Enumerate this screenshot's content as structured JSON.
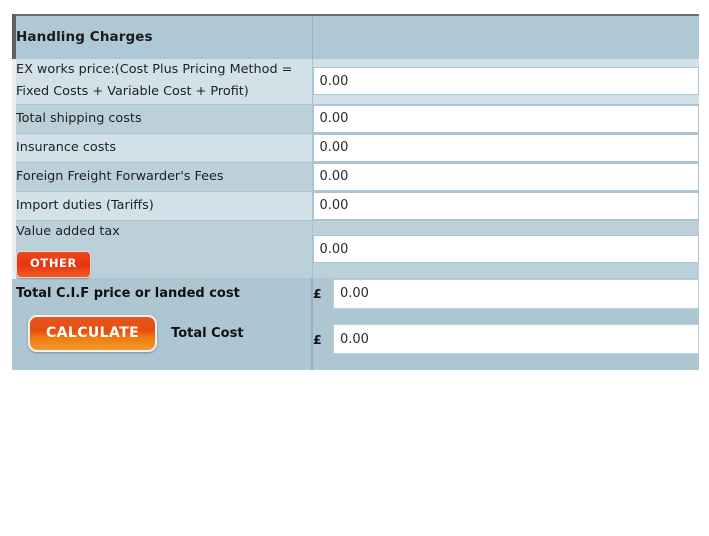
{
  "table": {
    "header": {
      "title": "Handling Charges",
      "second_column": ""
    },
    "rows": [
      {
        "label": "EX works price:(Cost Plus Pricing Method = Fixed Costs + Variable Cost + Profit)",
        "value": "0.00",
        "placeholder": "0.00"
      },
      {
        "label": "Total shipping costs",
        "value": "0.00",
        "placeholder": "0.00"
      },
      {
        "label": "Insurance costs",
        "value": "0.00",
        "placeholder": "0.00"
      },
      {
        "label": "Foreign Freight Forwarder's Fees",
        "value": "0.00",
        "placeholder": "0.00"
      },
      {
        "label": "Import duties (Tariffs)",
        "value": "0.00",
        "placeholder": "0.00"
      },
      {
        "label": "Value added tax",
        "button_label": "OTHER",
        "value": "0.00",
        "placeholder": "0.00"
      }
    ],
    "totals": [
      {
        "label": "Total C.I.F price or landed cost",
        "currency": "£",
        "value": "0.00",
        "placeholder": "0.00"
      },
      {
        "button_label": "CALCULATE",
        "caption": "Total Cost",
        "currency": "£",
        "value": "0.00",
        "placeholder": "0.00"
      }
    ]
  },
  "colors": {
    "header_bg": "#aec8d6",
    "row_dark_bg": "#bcd0da",
    "row_light_bg": "#d2e0e8",
    "total_bg": "#aec6d2",
    "button_other": "#e8360f",
    "button_calculate": "#e4500f",
    "input_border": "#a9c4d6",
    "page_bg": "#ffffff"
  }
}
